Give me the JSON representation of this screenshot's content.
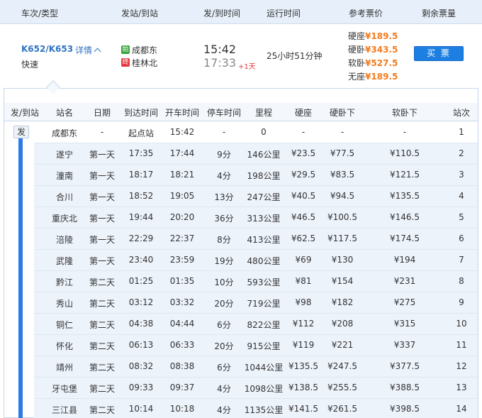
{
  "header": {
    "train_no_type": "车次/类型",
    "stations": "发站/到站",
    "times": "发/到时间",
    "duration": "运行时间",
    "prices": "参考票价",
    "remaining": "剩余票量"
  },
  "train": {
    "number": "K652/K653",
    "detail_link": "详情",
    "type": "快速",
    "from_badge": "始",
    "from_station": "成都东",
    "to_badge": "终",
    "to_station": "桂林北",
    "depart_time": "15:42",
    "arrive_time": "17:33",
    "plus_days": "+1天",
    "duration": "25小时51分钟",
    "prices": [
      {
        "seat": "硬座",
        "price": "¥189.5"
      },
      {
        "seat": "硬卧",
        "price": "¥343.5"
      },
      {
        "seat": "软卧",
        "price": "¥527.5"
      },
      {
        "seat": "无座",
        "price": "¥189.5"
      }
    ],
    "buy_label": "买 票",
    "colors": {
      "link": "#2f73c3",
      "price": "#f37b1d",
      "button": "#1c7fe1",
      "from_badge": "#3aa33a",
      "to_badge": "#e4393c"
    }
  },
  "stops": {
    "depart_badge": "发",
    "columns": [
      "发/到站",
      "站名",
      "日期",
      "到达时间",
      "开车时间",
      "停车时间",
      "里程",
      "硬座",
      "硬卧下",
      "软卧下",
      "站次"
    ],
    "rows": [
      {
        "name": "成都东",
        "day": "-",
        "arrive": "起点站",
        "depart": "15:42",
        "stop": "-",
        "km": "0",
        "hard_seat": "-",
        "hard_sleeper": "-",
        "soft_sleeper": "-",
        "no": "1"
      },
      {
        "name": "遂宁",
        "day": "第一天",
        "arrive": "17:35",
        "depart": "17:44",
        "stop": "9分",
        "km": "146公里",
        "hard_seat": "¥23.5",
        "hard_sleeper": "¥77.5",
        "soft_sleeper": "¥110.5",
        "no": "2"
      },
      {
        "name": "潼南",
        "day": "第一天",
        "arrive": "18:17",
        "depart": "18:21",
        "stop": "4分",
        "km": "198公里",
        "hard_seat": "¥29.5",
        "hard_sleeper": "¥83.5",
        "soft_sleeper": "¥121.5",
        "no": "3"
      },
      {
        "name": "合川",
        "day": "第一天",
        "arrive": "18:52",
        "depart": "19:05",
        "stop": "13分",
        "km": "247公里",
        "hard_seat": "¥40.5",
        "hard_sleeper": "¥94.5",
        "soft_sleeper": "¥135.5",
        "no": "4"
      },
      {
        "name": "重庆北",
        "day": "第一天",
        "arrive": "19:44",
        "depart": "20:20",
        "stop": "36分",
        "km": "313公里",
        "hard_seat": "¥46.5",
        "hard_sleeper": "¥100.5",
        "soft_sleeper": "¥146.5",
        "no": "5"
      },
      {
        "name": "涪陵",
        "day": "第一天",
        "arrive": "22:29",
        "depart": "22:37",
        "stop": "8分",
        "km": "413公里",
        "hard_seat": "¥62.5",
        "hard_sleeper": "¥117.5",
        "soft_sleeper": "¥174.5",
        "no": "6"
      },
      {
        "name": "武隆",
        "day": "第一天",
        "arrive": "23:40",
        "depart": "23:59",
        "stop": "19分",
        "km": "480公里",
        "hard_seat": "¥69",
        "hard_sleeper": "¥130",
        "soft_sleeper": "¥194",
        "no": "7"
      },
      {
        "name": "黔江",
        "day": "第二天",
        "arrive": "01:25",
        "depart": "01:35",
        "stop": "10分",
        "km": "593公里",
        "hard_seat": "¥81",
        "hard_sleeper": "¥154",
        "soft_sleeper": "¥231",
        "no": "8"
      },
      {
        "name": "秀山",
        "day": "第二天",
        "arrive": "03:12",
        "depart": "03:32",
        "stop": "20分",
        "km": "719公里",
        "hard_seat": "¥98",
        "hard_sleeper": "¥182",
        "soft_sleeper": "¥275",
        "no": "9"
      },
      {
        "name": "铜仁",
        "day": "第二天",
        "arrive": "04:38",
        "depart": "04:44",
        "stop": "6分",
        "km": "822公里",
        "hard_seat": "¥112",
        "hard_sleeper": "¥208",
        "soft_sleeper": "¥315",
        "no": "10"
      },
      {
        "name": "怀化",
        "day": "第二天",
        "arrive": "06:13",
        "depart": "06:33",
        "stop": "20分",
        "km": "915公里",
        "hard_seat": "¥119",
        "hard_sleeper": "¥221",
        "soft_sleeper": "¥337",
        "no": "11"
      },
      {
        "name": "靖州",
        "day": "第二天",
        "arrive": "08:32",
        "depart": "08:38",
        "stop": "6分",
        "km": "1044公里",
        "hard_seat": "¥135.5",
        "hard_sleeper": "¥247.5",
        "soft_sleeper": "¥377.5",
        "no": "12"
      },
      {
        "name": "牙屯堡",
        "day": "第二天",
        "arrive": "09:33",
        "depart": "09:37",
        "stop": "4分",
        "km": "1098公里",
        "hard_seat": "¥138.5",
        "hard_sleeper": "¥255.5",
        "soft_sleeper": "¥388.5",
        "no": "13"
      },
      {
        "name": "三江县",
        "day": "第二天",
        "arrive": "10:14",
        "depart": "10:18",
        "stop": "4分",
        "km": "1135公里",
        "hard_seat": "¥141.5",
        "hard_sleeper": "¥261.5",
        "soft_sleeper": "¥398.5",
        "no": "14"
      }
    ]
  }
}
